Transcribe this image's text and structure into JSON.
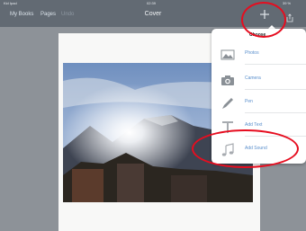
{
  "status_bar": {
    "carrier": "Kid Ipad",
    "time": "02:39",
    "battery": "39 %"
  },
  "nav": {
    "left_links": [
      "My Books",
      "Pages",
      "Undo"
    ],
    "title": "Cover"
  },
  "menu": {
    "title": "Choose",
    "items": [
      {
        "label": "Photos",
        "icon": "photos-icon"
      },
      {
        "label": "Camera",
        "icon": "camera-icon"
      },
      {
        "label": "Pen",
        "icon": "pen-icon"
      },
      {
        "label": "Add Text",
        "icon": "text-icon"
      },
      {
        "label": "Add Sound",
        "icon": "music-note-icon"
      }
    ]
  },
  "colors": {
    "toolbar": "#626a73",
    "background": "#8d9298",
    "link": "#5a8fcc",
    "annotation": "#e60d1f"
  }
}
